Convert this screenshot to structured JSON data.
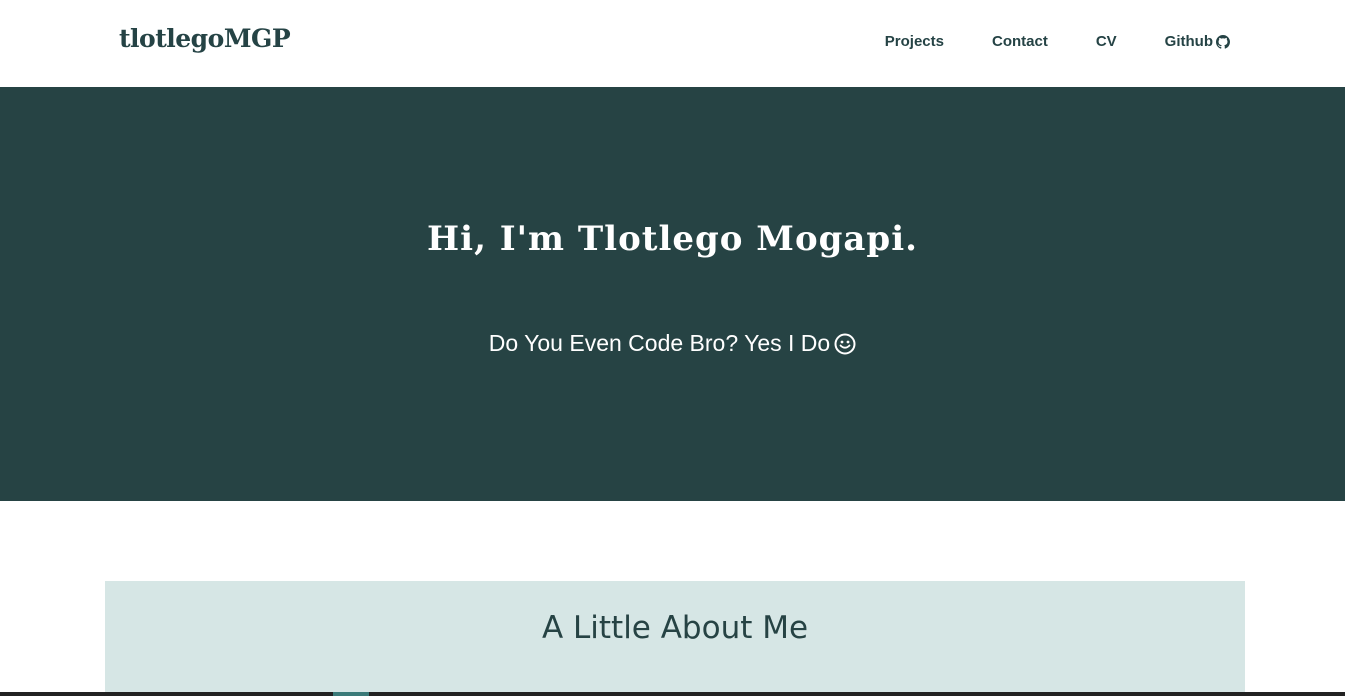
{
  "navbar": {
    "brand": "tlotlegoMGP",
    "links": [
      {
        "label": "Projects"
      },
      {
        "label": "Contact"
      },
      {
        "label": "CV"
      },
      {
        "label": "Github",
        "icon": "github-icon"
      }
    ]
  },
  "hero": {
    "title": "Hi, I'm Tlotlego Mogapi.",
    "subtitle": "Do You Even Code Bro? Yes I Do",
    "subtitle_icon": "smile-icon"
  },
  "about": {
    "title": "A Little About Me"
  },
  "colors": {
    "primary_dark": "#264344",
    "about_bg": "#d6e6e5",
    "nav_text": "#254345",
    "white": "#ffffff"
  }
}
